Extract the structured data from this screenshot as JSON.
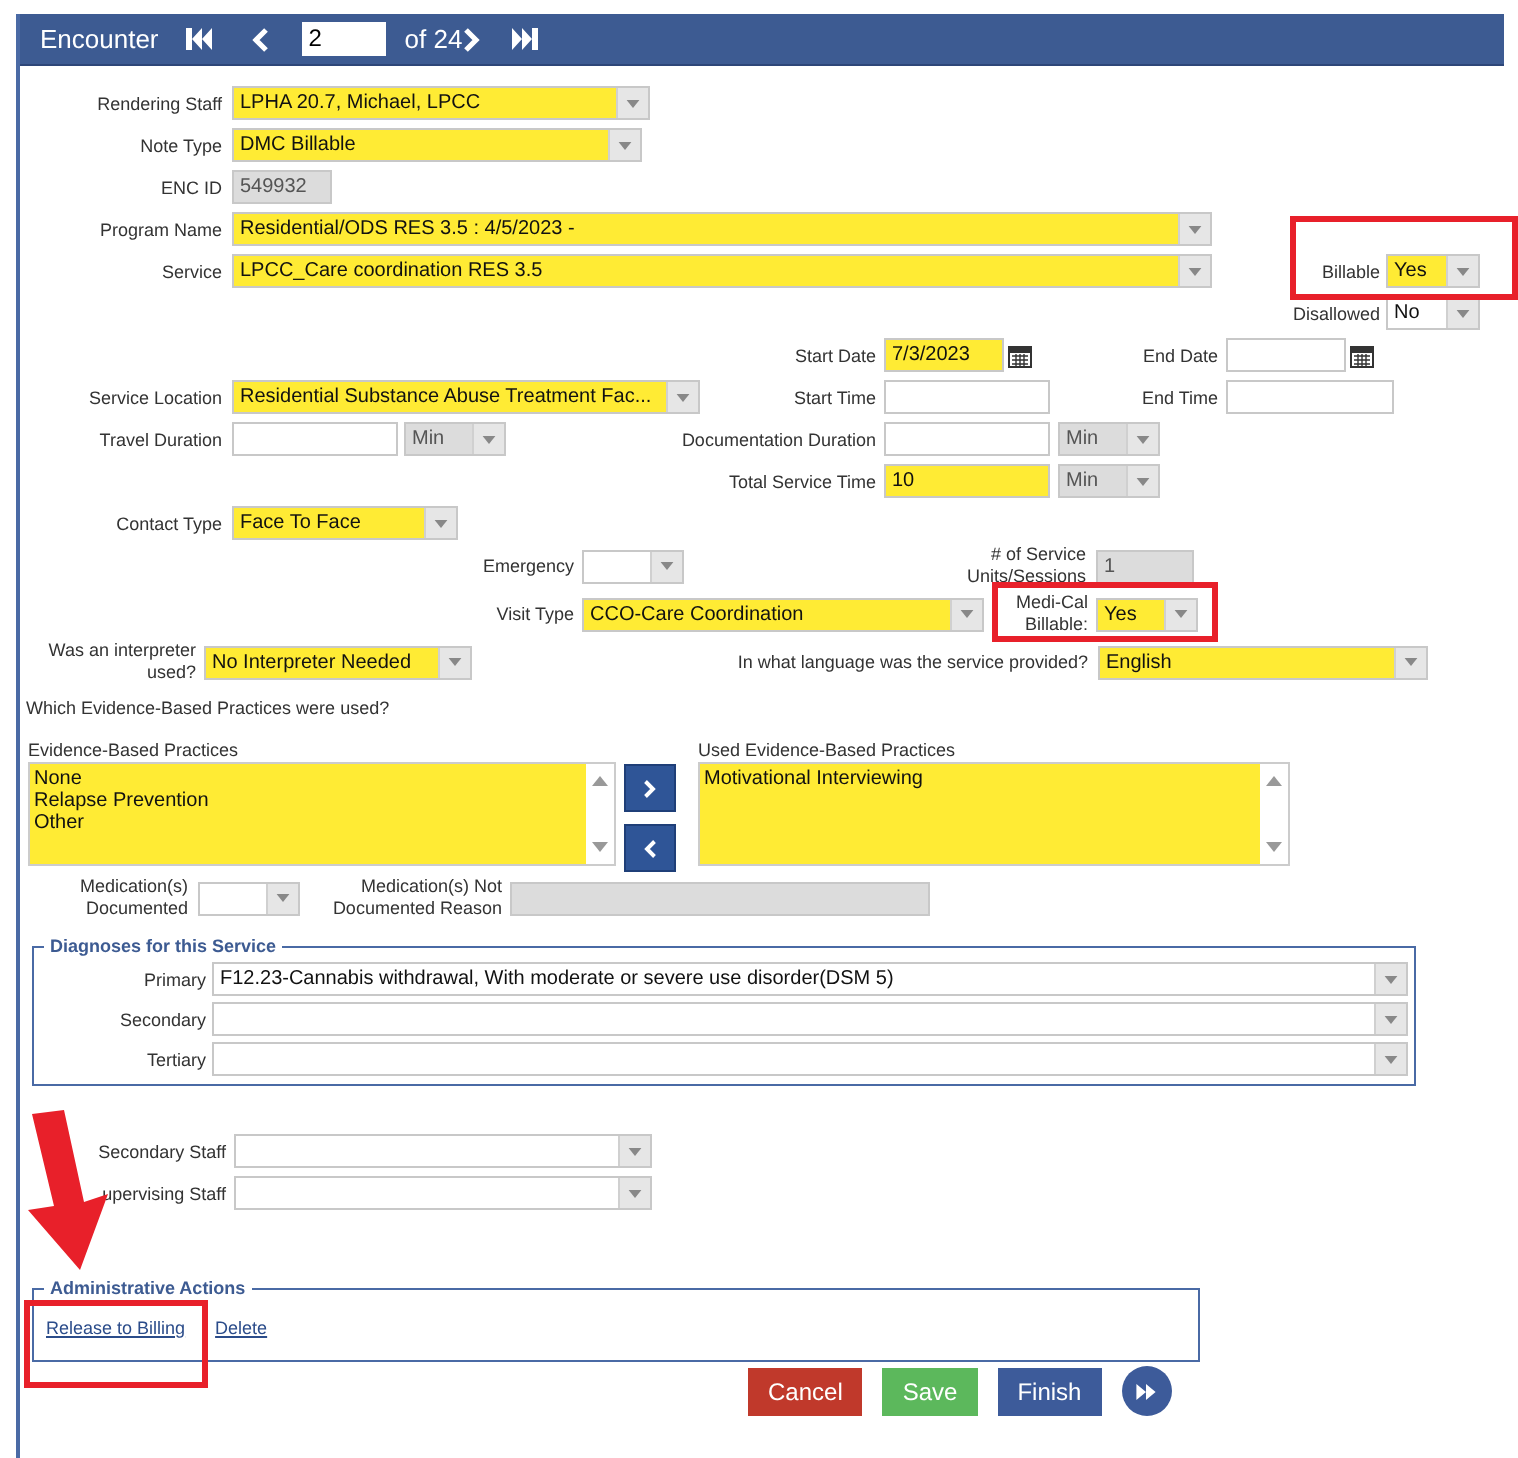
{
  "header": {
    "title": "Encounter",
    "record": "2",
    "total": "of 24"
  },
  "rendering_staff": {
    "label": "Rendering Staff",
    "value": "LPHA 20.7, Michael, LPCC",
    "required": true
  },
  "note_type": {
    "label": "Note Type",
    "value": "DMC Billable",
    "required": true
  },
  "enc_id": {
    "label": "ENC ID",
    "value": "549932",
    "disabled": true
  },
  "program_name": {
    "label": "Program Name",
    "value": "Residential/ODS RES 3.5 : 4/5/2023 -",
    "required": true
  },
  "service": {
    "label": "Service",
    "value": "LPCC_Care coordination RES 3.5",
    "required": true
  },
  "billable": {
    "label": "Billable",
    "value": "Yes",
    "required": true
  },
  "disallowed": {
    "label": "Disallowed",
    "value": "No",
    "required": false
  },
  "start_date": {
    "label": "Start Date",
    "value": "7/3/2023",
    "required": true
  },
  "end_date": {
    "label": "End Date",
    "required": false
  },
  "service_location": {
    "label": "Service Location",
    "value": "Residential Substance Abuse Treatment Fac...",
    "required": true
  },
  "start_time": {
    "label": "Start Time",
    "required": false
  },
  "end_time": {
    "label": "End Time",
    "required": false
  },
  "travel_duration": {
    "label": "Travel Duration",
    "required": false,
    "unit": {
      "value": "Min",
      "disabled": true
    }
  },
  "documentation_duration": {
    "label": "Documentation Duration",
    "required": false,
    "unit": {
      "value": "Min",
      "disabled": true
    }
  },
  "total_service_time": {
    "label": "Total Service Time",
    "value": "10",
    "required": true,
    "unit": {
      "value": "Min",
      "disabled": true
    }
  },
  "contact_type": {
    "label": "Contact Type",
    "value": "Face To Face",
    "required": true
  },
  "emergency": {
    "label": "Emergency",
    "required": false
  },
  "service_units": {
    "label": "# of Service Units/Sessions",
    "value": "1",
    "disabled": true
  },
  "visit_type": {
    "label": "Visit Type",
    "value": "CCO-Care Coordination",
    "required": true
  },
  "medi_cal_billable": {
    "label": "Medi-Cal Billable:",
    "value": "Yes",
    "required": true
  },
  "interpreter": {
    "label": "Was an interpreter used?",
    "value": "No Interpreter Needed",
    "required": true
  },
  "language": {
    "label": "In what language was the service provided?",
    "value": "English",
    "required": true
  },
  "practices_question": "Which Evidence-Based Practices were used?",
  "available_practices": {
    "label": "Evidence-Based Practices",
    "items": [
      "None",
      "Relapse Prevention",
      "Other"
    ]
  },
  "used_practices": {
    "label": "Used Evidence-Based Practices",
    "items": [
      "Motivational Interviewing"
    ]
  },
  "medications_documented": {
    "label": "Medication(s) Documented",
    "required": false
  },
  "medications_reason": {
    "label": "Medication(s) Not Documented Reason",
    "disabled": true
  },
  "diagnoses": {
    "title": "Diagnoses for this Service",
    "rows": [
      {
        "label": "Primary",
        "value": "F12.23-Cannabis withdrawal, With moderate or severe use disorder(DSM 5)",
        "required": false
      },
      {
        "label": "Secondary",
        "required": false
      },
      {
        "label": "Tertiary",
        "required": false
      }
    ]
  },
  "secondary_staff": {
    "label": "Secondary Staff",
    "required": false
  },
  "supervising_staff": {
    "label": "upervising Staff",
    "required": false
  },
  "administrative_actions": {
    "title": "Administrative Actions",
    "links": [
      "Release to Billing",
      "Delete"
    ]
  },
  "buttons": [
    {
      "label": "Cancel",
      "kind": "danger"
    },
    {
      "label": "Save",
      "kind": "success"
    },
    {
      "label": "Finish",
      "kind": "primary"
    }
  ],
  "annotations": [
    {
      "kind": "frame"
    },
    {
      "kind": "frame"
    },
    {
      "kind": "frame"
    },
    {
      "kind": "arrow"
    }
  ]
}
